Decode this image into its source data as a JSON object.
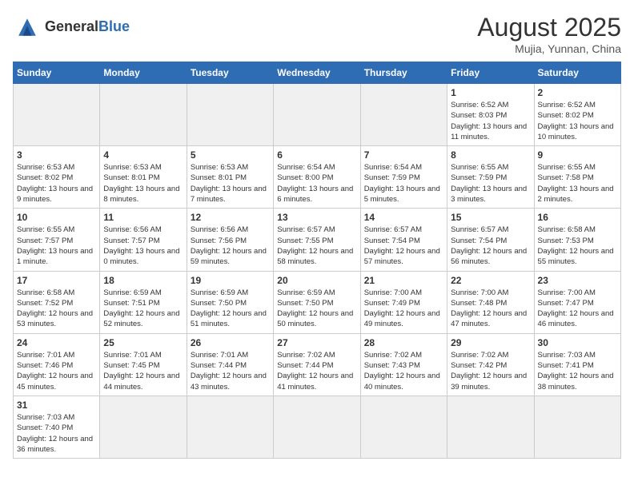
{
  "header": {
    "logo_text_general": "General",
    "logo_text_blue": "Blue",
    "month_title": "August 2025",
    "location": "Mujia, Yunnan, China"
  },
  "weekdays": [
    "Sunday",
    "Monday",
    "Tuesday",
    "Wednesday",
    "Thursday",
    "Friday",
    "Saturday"
  ],
  "weeks": [
    [
      {
        "day": "",
        "info": ""
      },
      {
        "day": "",
        "info": ""
      },
      {
        "day": "",
        "info": ""
      },
      {
        "day": "",
        "info": ""
      },
      {
        "day": "",
        "info": ""
      },
      {
        "day": "1",
        "info": "Sunrise: 6:52 AM\nSunset: 8:03 PM\nDaylight: 13 hours and 11 minutes."
      },
      {
        "day": "2",
        "info": "Sunrise: 6:52 AM\nSunset: 8:02 PM\nDaylight: 13 hours and 10 minutes."
      }
    ],
    [
      {
        "day": "3",
        "info": "Sunrise: 6:53 AM\nSunset: 8:02 PM\nDaylight: 13 hours and 9 minutes."
      },
      {
        "day": "4",
        "info": "Sunrise: 6:53 AM\nSunset: 8:01 PM\nDaylight: 13 hours and 8 minutes."
      },
      {
        "day": "5",
        "info": "Sunrise: 6:53 AM\nSunset: 8:01 PM\nDaylight: 13 hours and 7 minutes."
      },
      {
        "day": "6",
        "info": "Sunrise: 6:54 AM\nSunset: 8:00 PM\nDaylight: 13 hours and 6 minutes."
      },
      {
        "day": "7",
        "info": "Sunrise: 6:54 AM\nSunset: 7:59 PM\nDaylight: 13 hours and 5 minutes."
      },
      {
        "day": "8",
        "info": "Sunrise: 6:55 AM\nSunset: 7:59 PM\nDaylight: 13 hours and 3 minutes."
      },
      {
        "day": "9",
        "info": "Sunrise: 6:55 AM\nSunset: 7:58 PM\nDaylight: 13 hours and 2 minutes."
      }
    ],
    [
      {
        "day": "10",
        "info": "Sunrise: 6:55 AM\nSunset: 7:57 PM\nDaylight: 13 hours and 1 minute."
      },
      {
        "day": "11",
        "info": "Sunrise: 6:56 AM\nSunset: 7:57 PM\nDaylight: 13 hours and 0 minutes."
      },
      {
        "day": "12",
        "info": "Sunrise: 6:56 AM\nSunset: 7:56 PM\nDaylight: 12 hours and 59 minutes."
      },
      {
        "day": "13",
        "info": "Sunrise: 6:57 AM\nSunset: 7:55 PM\nDaylight: 12 hours and 58 minutes."
      },
      {
        "day": "14",
        "info": "Sunrise: 6:57 AM\nSunset: 7:54 PM\nDaylight: 12 hours and 57 minutes."
      },
      {
        "day": "15",
        "info": "Sunrise: 6:57 AM\nSunset: 7:54 PM\nDaylight: 12 hours and 56 minutes."
      },
      {
        "day": "16",
        "info": "Sunrise: 6:58 AM\nSunset: 7:53 PM\nDaylight: 12 hours and 55 minutes."
      }
    ],
    [
      {
        "day": "17",
        "info": "Sunrise: 6:58 AM\nSunset: 7:52 PM\nDaylight: 12 hours and 53 minutes."
      },
      {
        "day": "18",
        "info": "Sunrise: 6:59 AM\nSunset: 7:51 PM\nDaylight: 12 hours and 52 minutes."
      },
      {
        "day": "19",
        "info": "Sunrise: 6:59 AM\nSunset: 7:50 PM\nDaylight: 12 hours and 51 minutes."
      },
      {
        "day": "20",
        "info": "Sunrise: 6:59 AM\nSunset: 7:50 PM\nDaylight: 12 hours and 50 minutes."
      },
      {
        "day": "21",
        "info": "Sunrise: 7:00 AM\nSunset: 7:49 PM\nDaylight: 12 hours and 49 minutes."
      },
      {
        "day": "22",
        "info": "Sunrise: 7:00 AM\nSunset: 7:48 PM\nDaylight: 12 hours and 47 minutes."
      },
      {
        "day": "23",
        "info": "Sunrise: 7:00 AM\nSunset: 7:47 PM\nDaylight: 12 hours and 46 minutes."
      }
    ],
    [
      {
        "day": "24",
        "info": "Sunrise: 7:01 AM\nSunset: 7:46 PM\nDaylight: 12 hours and 45 minutes."
      },
      {
        "day": "25",
        "info": "Sunrise: 7:01 AM\nSunset: 7:45 PM\nDaylight: 12 hours and 44 minutes."
      },
      {
        "day": "26",
        "info": "Sunrise: 7:01 AM\nSunset: 7:44 PM\nDaylight: 12 hours and 43 minutes."
      },
      {
        "day": "27",
        "info": "Sunrise: 7:02 AM\nSunset: 7:44 PM\nDaylight: 12 hours and 41 minutes."
      },
      {
        "day": "28",
        "info": "Sunrise: 7:02 AM\nSunset: 7:43 PM\nDaylight: 12 hours and 40 minutes."
      },
      {
        "day": "29",
        "info": "Sunrise: 7:02 AM\nSunset: 7:42 PM\nDaylight: 12 hours and 39 minutes."
      },
      {
        "day": "30",
        "info": "Sunrise: 7:03 AM\nSunset: 7:41 PM\nDaylight: 12 hours and 38 minutes."
      }
    ],
    [
      {
        "day": "31",
        "info": "Sunrise: 7:03 AM\nSunset: 7:40 PM\nDaylight: 12 hours and 36 minutes."
      },
      {
        "day": "",
        "info": ""
      },
      {
        "day": "",
        "info": ""
      },
      {
        "day": "",
        "info": ""
      },
      {
        "day": "",
        "info": ""
      },
      {
        "day": "",
        "info": ""
      },
      {
        "day": "",
        "info": ""
      }
    ]
  ]
}
